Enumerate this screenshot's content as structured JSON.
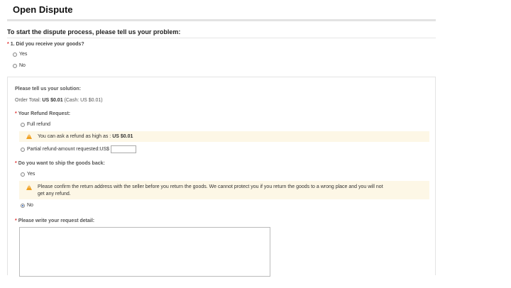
{
  "header": {
    "title": "Open Dispute"
  },
  "intro": {
    "text": "To start the dispute process, please tell us your problem:"
  },
  "question1": {
    "required_mark": "*",
    "label": "1. Did you receive your goods?",
    "options": [
      {
        "label": "Yes",
        "checked": false
      },
      {
        "label": "No",
        "checked": false
      }
    ]
  },
  "solution": {
    "label": "Please tell us your solution:",
    "order_total_prefix": "Order Total:",
    "order_total_value": "US $0.01",
    "order_total_cash": "(Cash: US $0.01)",
    "refund_request": {
      "required_mark": "*",
      "label": "Your Refund Request:",
      "full_refund": "Full refund",
      "warning_text": "You can ask a refund as high as :",
      "warning_amount": "US $0.01",
      "partial_refund": "Partial refund-amount requested:US$",
      "partial_value": ""
    },
    "ship_back": {
      "required_mark": "*",
      "label": "Do you want to ship the goods back:",
      "yes": "Yes",
      "warning_line1": "Please confirm the return address with the seller before you return the goods. We cannot protect you if you return the goods to a wrong place and you will not",
      "warning_line2": "get any refund.",
      "no": "No",
      "selected": "No"
    },
    "detail": {
      "required_mark": "*",
      "label": "Please write your request detail:",
      "value": ""
    }
  },
  "colors": {
    "warning_bg": "#fdf7e6",
    "warning_icon": "#f0a020",
    "required": "#e03030",
    "radio_checked": "#2a5fb8"
  }
}
